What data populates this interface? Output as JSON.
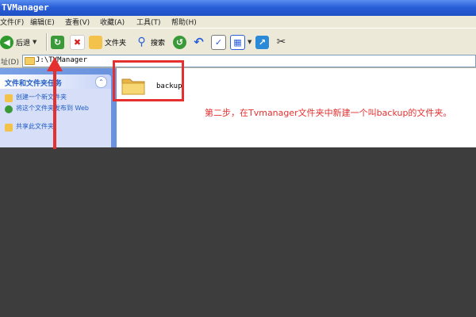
{
  "window": {
    "title": "TVManager"
  },
  "menu": {
    "items": [
      "文件(F)",
      "编辑(E)",
      "查看(V)",
      "收藏(A)",
      "工具(T)",
      "帮助(H)"
    ]
  },
  "toolbar": {
    "back_label": "后退",
    "folders_label": "文件夹",
    "search_label": "搜索"
  },
  "address": {
    "label": "址(D)",
    "path": "J:\\TVManager"
  },
  "tasks": {
    "title": "文件和文件夹任务",
    "items": [
      {
        "label": "创建一个新文件夹",
        "icon": "new-folder-icon",
        "color": "#f3c24a"
      },
      {
        "label": "将这个文件夹发布到 Web",
        "icon": "publish-web-icon",
        "color": "#3a9a3a"
      },
      {
        "label": "共享此文件夹",
        "icon": "share-folder-icon",
        "color": "#f3c24a"
      }
    ]
  },
  "content": {
    "folders": [
      {
        "name": "backup",
        "icon": "folder-icon"
      }
    ]
  },
  "annotation": {
    "text": "第二步，在Tvmanager文件夹中新建一个叫backup的文件夹。",
    "color": "#e53030"
  },
  "colors": {
    "titlebar": "#2a5fd8",
    "taskpane": "#6a92dd",
    "highlight": "#e53030"
  }
}
